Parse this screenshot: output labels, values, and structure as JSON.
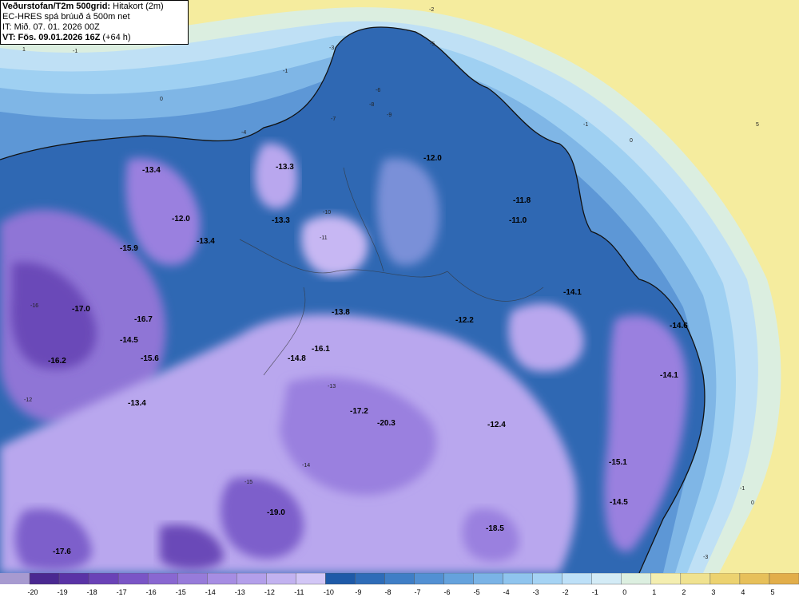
{
  "header": {
    "title_main": "Veðurstofan/T2m 500grid:",
    "title_suffix": "Hitakort (2m)",
    "model_line": "EC-HRES spá brúuð á 500m net",
    "init_line": "IT: Mið. 07. 01. 2026 00Z",
    "valid_line": "VT: Fös. 09.01.2026 16Z",
    "lead_time": "(+64 h)"
  },
  "temperature_labels": [
    "-13.4",
    "-12.0",
    "-13.4",
    "-15.9",
    "-17.0",
    "-16.7",
    "-14.5",
    "-16.2",
    "-15.6",
    "-13.4",
    "-13.3",
    "-13.3",
    "-12.0",
    "-11.8",
    "-11.0",
    "-14.1",
    "-13.8",
    "-16.1",
    "-14.8",
    "-12.2",
    "-14.6",
    "-14.1",
    "-17.2",
    "-20.3",
    "-12.4",
    "-15.1",
    "-19.0",
    "-14.5",
    "-17.6",
    "-18.5"
  ],
  "isotherm_labels": [
    "-2",
    "-1",
    "0",
    "-3",
    "-4",
    "-5",
    "-6",
    "-7",
    "-8",
    "-9",
    "-10",
    "-11",
    "-12",
    "-13",
    "-14",
    "-15",
    "-16",
    "1",
    "5"
  ],
  "legend": {
    "values": [
      "-20",
      "-19",
      "-18",
      "-17",
      "-16",
      "-15",
      "-14",
      "-13",
      "-12",
      "-11",
      "-10",
      "-9",
      "-8",
      "-7",
      "-6",
      "-5",
      "-4",
      "-3",
      "-2",
      "-1",
      "0",
      "1",
      "2",
      "3",
      "4",
      "5"
    ],
    "colors": [
      "#4a2891",
      "#5a33a6",
      "#6a42b7",
      "#7a55c6",
      "#8967d1",
      "#977bda",
      "#a68de3",
      "#b39fea",
      "#c2b2f0",
      "#d2c6f6",
      "#1e5aa8",
      "#2e6cb8",
      "#3f7ec6",
      "#5290d3",
      "#65a2dd",
      "#7ab3e6",
      "#8fc4ee",
      "#a5d3f4",
      "#bde0f8",
      "#d3ebf6",
      "#dcefe0",
      "#f4eeb0",
      "#f0e290",
      "#ecd270",
      "#e7c05a",
      "#e2ae4a"
    ]
  }
}
